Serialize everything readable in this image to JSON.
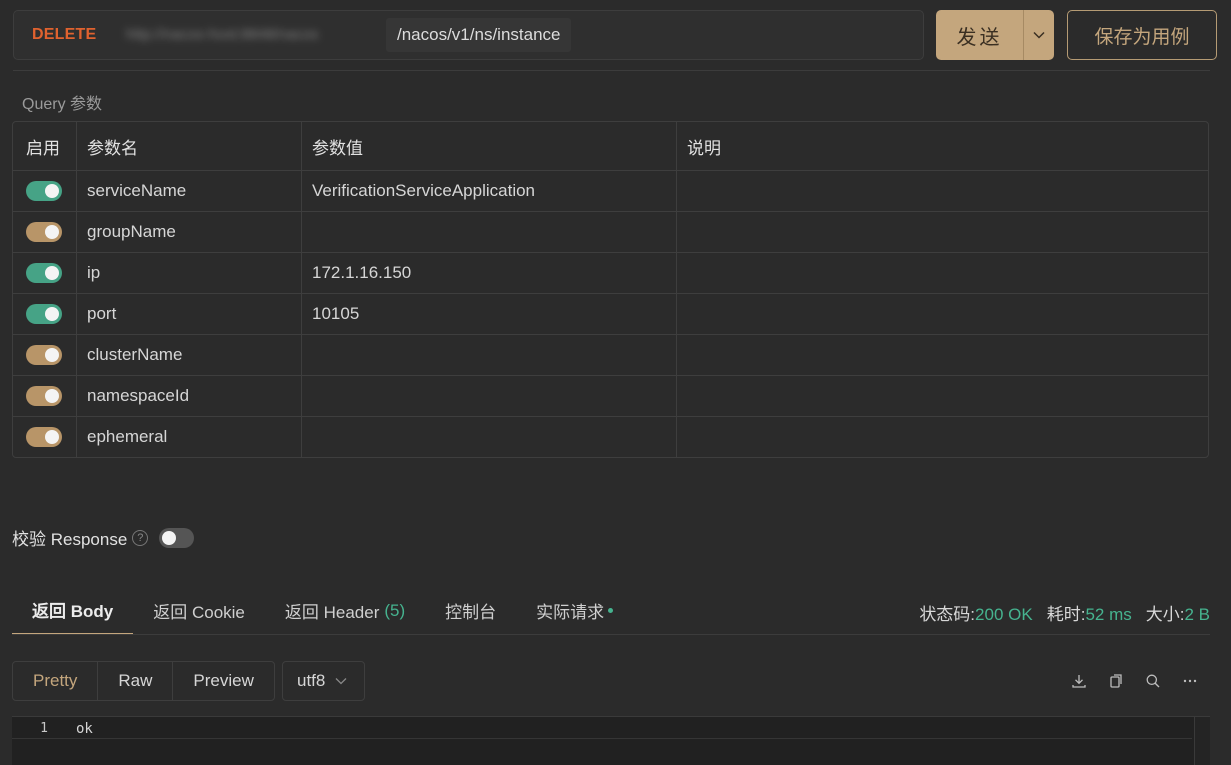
{
  "request": {
    "method": "DELETE",
    "base_url": "http://nacos-host:8848/nacos",
    "path": "/nacos/v1/ns/instance"
  },
  "buttons": {
    "send": "发送",
    "save_as_case": "保存为用例"
  },
  "query": {
    "title": "Query 参数",
    "headers": {
      "enable": "启用",
      "name": "参数名",
      "value": "参数值",
      "desc": "说明"
    },
    "params": [
      {
        "enabled": "on",
        "name": "serviceName",
        "value": "VerificationServiceApplication",
        "desc": ""
      },
      {
        "enabled": "partial",
        "name": "groupName",
        "value": "",
        "desc": ""
      },
      {
        "enabled": "on",
        "name": "ip",
        "value": "172.1.16.150",
        "desc": ""
      },
      {
        "enabled": "on",
        "name": "port",
        "value": "10105",
        "desc": ""
      },
      {
        "enabled": "partial",
        "name": "clusterName",
        "value": "",
        "desc": ""
      },
      {
        "enabled": "partial",
        "name": "namespaceId",
        "value": "",
        "desc": ""
      },
      {
        "enabled": "partial",
        "name": "ephemeral",
        "value": "",
        "desc": ""
      }
    ]
  },
  "validate": {
    "label": "校验 Response",
    "help": "?",
    "enabled": false
  },
  "tabs": {
    "body": "返回 Body",
    "cookie": "返回 Cookie",
    "header": "返回 Header",
    "header_count": "(5)",
    "console": "控制台",
    "actual_request": "实际请求"
  },
  "status": {
    "code_label": "状态码:",
    "code_value": "200 OK",
    "time_label": "耗时:",
    "time_value": "52 ms",
    "size_label": "大小:",
    "size_value": "2 B"
  },
  "format": {
    "pretty": "Pretty",
    "raw": "Raw",
    "preview": "Preview",
    "encoding": "utf8"
  },
  "body": {
    "lines": [
      {
        "no": "1",
        "text": "ok"
      }
    ]
  },
  "colors": {
    "accent": "#c4a67d",
    "method": "#e0622f",
    "toggle_on": "#46a386",
    "toggle_partial": "#b89568",
    "success": "#46b38f",
    "background": "#2b2b2b"
  },
  "icons": [
    "chevron-down-icon",
    "help-icon",
    "download-icon",
    "copy-icon",
    "search-icon",
    "more-icon"
  ]
}
